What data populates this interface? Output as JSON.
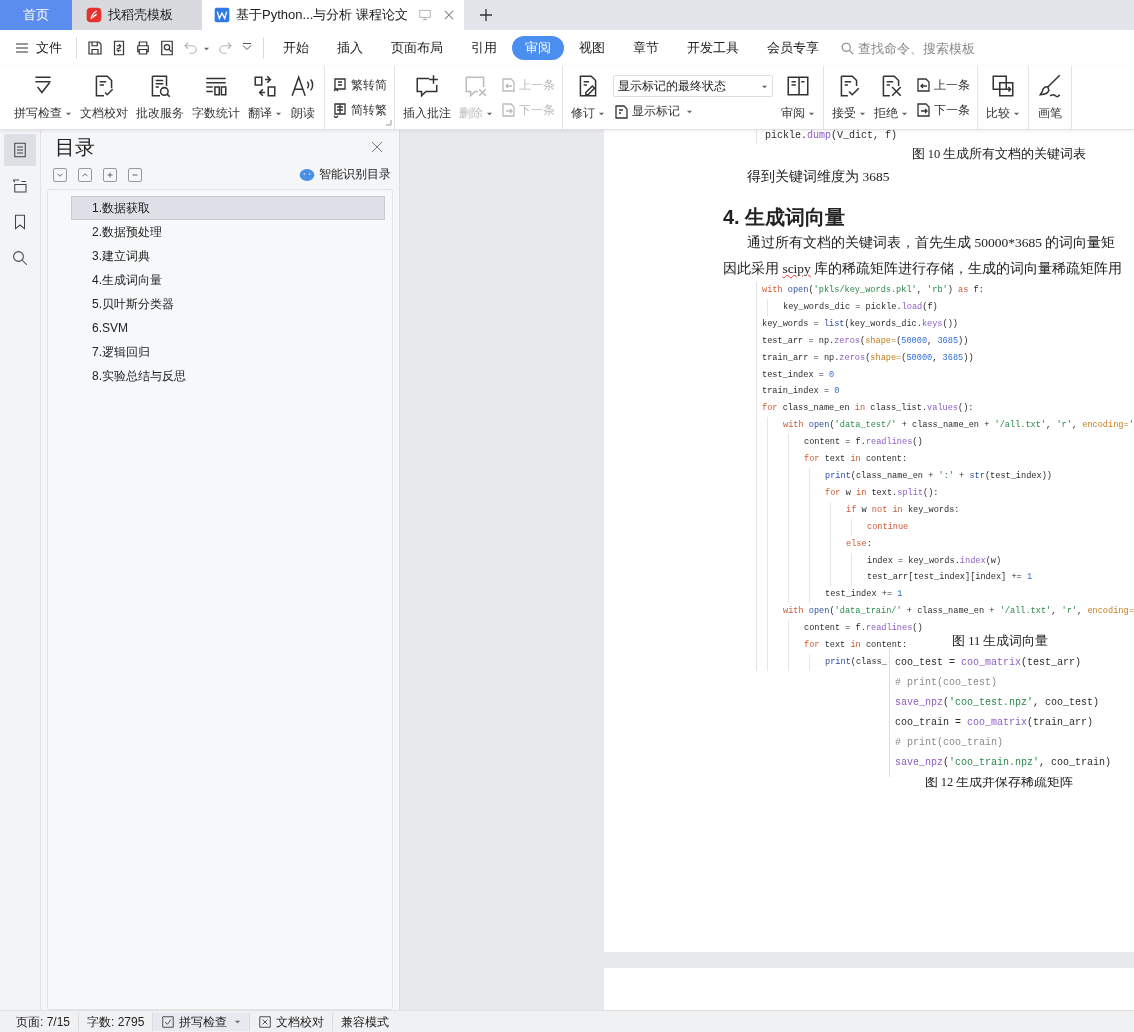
{
  "tabs": [
    {
      "label": "首页",
      "kind": "home",
      "selected": false
    },
    {
      "label": "找稻壳模板",
      "kind": "template",
      "selected": false
    },
    {
      "label": "基于Python...与分析 课程论文",
      "kind": "document",
      "selected": true
    }
  ],
  "menu": {
    "file": "文件",
    "quick_tools": [
      {
        "disabled": false
      },
      {
        "disabled": false
      },
      {
        "disabled": false
      },
      {
        "disabled": false
      },
      {
        "disabled": true
      },
      {
        "disabled": true
      }
    ],
    "tabs": [
      {
        "label": "开始",
        "selected": false
      },
      {
        "label": "插入",
        "selected": false
      },
      {
        "label": "页面布局",
        "selected": false
      },
      {
        "label": "引用",
        "selected": false
      },
      {
        "label": "审阅",
        "selected": true
      },
      {
        "label": "视图",
        "selected": false
      },
      {
        "label": "章节",
        "selected": false
      },
      {
        "label": "开发工具",
        "selected": false
      },
      {
        "label": "会员专享",
        "selected": false
      }
    ],
    "search": {
      "placeholder": "查找命令、搜索模板"
    }
  },
  "ribbon": [
    {
      "items": [
        {
          "kind": "big",
          "label": "拼写检查",
          "dropdown": true,
          "disabled": false
        },
        {
          "kind": "big",
          "label": "文档校对",
          "dropdown": false,
          "disabled": false
        },
        {
          "kind": "big",
          "label": "批改服务",
          "dropdown": false,
          "disabled": false
        },
        {
          "kind": "big",
          "label": "字数统计",
          "dropdown": false,
          "disabled": false
        },
        {
          "kind": "big",
          "label": "翻译",
          "dropdown": true,
          "disabled": false
        },
        {
          "kind": "big",
          "label": "朗读",
          "dropdown": false,
          "disabled": false
        }
      ]
    },
    {
      "items": [
        {
          "kind": "pair",
          "items": [
            {
              "label": "繁转简",
              "disabled": false
            },
            {
              "label": "简转繁",
              "disabled": false
            }
          ]
        }
      ]
    },
    {
      "items": [
        {
          "kind": "big",
          "label": "插入批注",
          "dropdown": false,
          "disabled": false
        },
        {
          "kind": "big",
          "label": "删除",
          "dropdown": true,
          "disabled": true
        },
        {
          "kind": "pair",
          "items": [
            {
              "label": "上一条",
              "disabled": true
            },
            {
              "label": "下一条",
              "disabled": true
            }
          ]
        }
      ]
    },
    {
      "items": [
        {
          "kind": "big",
          "label": "修订",
          "dropdown": true,
          "disabled": false
        },
        {
          "kind": "select",
          "value": "显示标记的最终状态",
          "below": "显示标记"
        },
        {
          "kind": "big",
          "label": "审阅",
          "dropdown": true,
          "disabled": false
        }
      ]
    },
    {
      "items": [
        {
          "kind": "big",
          "label": "接受",
          "dropdown": true,
          "disabled": false
        },
        {
          "kind": "big",
          "label": "拒绝",
          "dropdown": true,
          "disabled": false
        },
        {
          "kind": "pair",
          "items": [
            {
              "label": "上一条",
              "disabled": false
            },
            {
              "label": "下一条",
              "disabled": false
            }
          ]
        }
      ]
    },
    {
      "items": [
        {
          "kind": "big",
          "label": "比较",
          "dropdown": true,
          "disabled": false
        }
      ]
    },
    {
      "items": [
        {
          "kind": "big",
          "label": "画笔",
          "dropdown": false,
          "disabled": false
        }
      ]
    }
  ],
  "nav": {
    "icons": [
      {
        "selected": true
      },
      {
        "selected": false
      },
      {
        "selected": false
      },
      {
        "selected": false
      }
    ],
    "title": "目录",
    "smart_button": "智能识别目录",
    "toc": [
      {
        "label": "1.数据获取",
        "selected": true
      },
      {
        "label": "2.数据预处理",
        "selected": false
      },
      {
        "label": "3.建立词典",
        "selected": false
      },
      {
        "label": "4.生成词向量",
        "selected": false
      },
      {
        "label": "5.贝叶斯分类器",
        "selected": false
      },
      {
        "label": "6.SVM",
        "selected": false
      },
      {
        "label": "7.逻辑回归",
        "selected": false
      },
      {
        "label": "8.实验总结与反思",
        "selected": false
      }
    ]
  },
  "document": [
    {
      "kind": "code",
      "lines": [
        {
          "tokens": [
            {
              "p": "pickle."
            },
            {
              "m": "dump"
            },
            {
              "p": "(V_dict, f)"
            }
          ]
        }
      ]
    },
    {
      "kind": "caption",
      "text": "图 10 生成所有文档的关键词表"
    },
    {
      "kind": "paragraph",
      "indent": true,
      "runs": [
        {
          "text": "得到关键词维度为 3685",
          "misspelled": false
        }
      ]
    },
    {
      "kind": "heading",
      "text": "4. 生成词向量"
    },
    {
      "kind": "paragraph",
      "indent": true,
      "runs": [
        {
          "text": "通过所有文档的关键词表，首先生成 50000*3685 的词向量矩",
          "misspelled": false
        }
      ]
    },
    {
      "kind": "paragraph",
      "indent": false,
      "runs": [
        {
          "text": "因此采用 ",
          "misspelled": false
        },
        {
          "text": "scipy",
          "misspelled": true
        },
        {
          "text": " 库的稀疏矩阵进行存储，生成的词向量稀疏矩阵用",
          "misspelled": false
        }
      ]
    },
    {
      "kind": "code",
      "lines": [
        {
          "tokens": [
            {
              "kw": "with "
            },
            {
              "fn": "open"
            },
            {
              "p": "("
            },
            {
              "str": "'pkls/key_words.pkl'"
            },
            {
              "p": ", "
            },
            {
              "str": "'rb'"
            },
            {
              "p": ") "
            },
            {
              "kw": "as"
            },
            {
              "p": " f:"
            }
          ],
          "children": [
            {
              "tokens": [
                {
                  "p": "key_words_dic = pickle."
                },
                {
                  "m": "load"
                },
                {
                  "p": "(f)"
                }
              ]
            }
          ]
        },
        {
          "tokens": [
            {
              "p": "key_words = "
            },
            {
              "fn": "list"
            },
            {
              "p": "(key_words_dic."
            },
            {
              "m": "keys"
            },
            {
              "p": "())"
            }
          ]
        },
        {
          "tokens": [
            {
              "p": "test_arr = np."
            },
            {
              "m": "zeros"
            },
            {
              "p": "("
            },
            {
              "par": "shape="
            },
            {
              "p": "("
            },
            {
              "num": "50000"
            },
            {
              "p": ", "
            },
            {
              "num": "3685"
            },
            {
              "p": "))"
            }
          ]
        },
        {
          "tokens": [
            {
              "p": "train_arr = np."
            },
            {
              "m": "zeros"
            },
            {
              "p": "("
            },
            {
              "par": "shape="
            },
            {
              "p": "("
            },
            {
              "num": "50000"
            },
            {
              "p": ", "
            },
            {
              "num": "3685"
            },
            {
              "p": "))"
            }
          ]
        },
        {
          "tokens": [
            {
              "p": "test_index = "
            },
            {
              "num": "0"
            }
          ]
        },
        {
          "tokens": [
            {
              "p": "train_index = "
            },
            {
              "num": "0"
            }
          ]
        },
        {
          "tokens": [
            {
              "kw": "for "
            },
            {
              "p": "class_name_en "
            },
            {
              "kw": "in "
            },
            {
              "p": "class_list."
            },
            {
              "m": "values"
            },
            {
              "p": "():"
            }
          ],
          "children": [
            {
              "tokens": [
                {
                  "kw": "with "
                },
                {
                  "fn": "open"
                },
                {
                  "p": "("
                },
                {
                  "str": "'data_test/'"
                },
                {
                  "p": " + class_name_en + "
                },
                {
                  "str": "'/all.txt'"
                },
                {
                  "p": ", "
                },
                {
                  "str": "'r'"
                },
                {
                  "p": ", "
                },
                {
                  "par": "encoding="
                },
                {
                  "str": "'"
                }
              ],
              "children": [
                {
                  "tokens": [
                    {
                      "p": "content = f."
                    },
                    {
                      "m": "readlines"
                    },
                    {
                      "p": "()"
                    }
                  ]
                },
                {
                  "tokens": [
                    {
                      "kw": "for "
                    },
                    {
                      "p": "text "
                    },
                    {
                      "kw": "in "
                    },
                    {
                      "p": "content:"
                    }
                  ],
                  "children": [
                    {
                      "tokens": [
                        {
                          "fn": "print"
                        },
                        {
                          "p": "(class_name_en + "
                        },
                        {
                          "str": "':'"
                        },
                        {
                          "p": " + "
                        },
                        {
                          "fn": "str"
                        },
                        {
                          "p": "(test_index))"
                        }
                      ]
                    },
                    {
                      "tokens": [
                        {
                          "kw": "for "
                        },
                        {
                          "p": "w "
                        },
                        {
                          "kw": "in "
                        },
                        {
                          "p": "text."
                        },
                        {
                          "m": "split"
                        },
                        {
                          "p": "():"
                        }
                      ],
                      "children": [
                        {
                          "tokens": [
                            {
                              "kw": "if "
                            },
                            {
                              "p": "w "
                            },
                            {
                              "kw": "not in "
                            },
                            {
                              "p": "key_words:"
                            }
                          ],
                          "children": [
                            {
                              "tokens": [
                                {
                                  "kw": "continue"
                                }
                              ]
                            }
                          ]
                        },
                        {
                          "tokens": [
                            {
                              "kw": "else"
                            },
                            {
                              "p": ":"
                            }
                          ],
                          "children": [
                            {
                              "tokens": [
                                {
                                  "p": "index = key_words."
                                },
                                {
                                  "m": "index"
                                },
                                {
                                  "p": "(w)"
                                }
                              ]
                            },
                            {
                              "tokens": [
                                {
                                  "p": "test_arr[test_index][index] += "
                                },
                                {
                                  "num": "1"
                                }
                              ]
                            }
                          ]
                        }
                      ]
                    },
                    {
                      "tokens": [
                        {
                          "p": "test_index += "
                        },
                        {
                          "num": "1"
                        }
                      ]
                    }
                  ]
                }
              ]
            },
            {
              "tokens": [
                {
                  "kw": "with "
                },
                {
                  "fn": "open"
                },
                {
                  "p": "("
                },
                {
                  "str": "'data_train/'"
                },
                {
                  "p": " + class_name_en + "
                },
                {
                  "str": "'/all.txt'"
                },
                {
                  "p": ", "
                },
                {
                  "str": "'r'"
                },
                {
                  "p": ", "
                },
                {
                  "par": "encoding="
                }
              ],
              "children": [
                {
                  "tokens": [
                    {
                      "p": "content = f."
                    },
                    {
                      "m": "readlines"
                    },
                    {
                      "p": "()"
                    }
                  ]
                },
                {
                  "tokens": [
                    {
                      "kw": "for "
                    },
                    {
                      "p": "text "
                    },
                    {
                      "kw": "in "
                    },
                    {
                      "p": "content:"
                    }
                  ],
                  "children": [
                    {
                      "tokens": [
                        {
                          "fn": "print"
                        },
                        {
                          "p": "(class_"
                        }
                      ]
                    }
                  ]
                }
              ]
            }
          ]
        }
      ],
      "overlays": [
        {
          "kind": "caption",
          "text": "图 11 生成词向量"
        },
        {
          "kind": "code",
          "lines": [
            {
              "tokens": [
                {
                  "p": "coo_test = "
                },
                {
                  "m": "coo_matrix"
                },
                {
                  "p": "(test_arr)"
                }
              ]
            },
            {
              "tokens": [
                {
                  "c": "# print(coo_test)"
                }
              ]
            },
            {
              "tokens": [
                {
                  "m": "save_npz"
                },
                {
                  "p": "("
                },
                {
                  "str": "'coo_test.npz'"
                },
                {
                  "p": ", coo_test)"
                }
              ]
            },
            {
              "tokens": [
                {
                  "p": "coo_train = "
                },
                {
                  "m": "coo_matrix"
                },
                {
                  "p": "(train_arr)"
                }
              ]
            },
            {
              "tokens": [
                {
                  "c": "# print(coo_train)"
                }
              ]
            },
            {
              "tokens": [
                {
                  "m": "save_npz"
                },
                {
                  "p": "("
                },
                {
                  "str": "'coo_train.npz'"
                },
                {
                  "p": ", coo_train)"
                }
              ]
            }
          ]
        }
      ]
    },
    {
      "kind": "caption",
      "text": "图 12 生成并保存稀疏矩阵"
    }
  ],
  "status_bar": {
    "page": "页面: 7/15",
    "words": "字数: 2795",
    "spell": "拼写检查",
    "proof": "文档校对",
    "mode": "兼容模式"
  }
}
